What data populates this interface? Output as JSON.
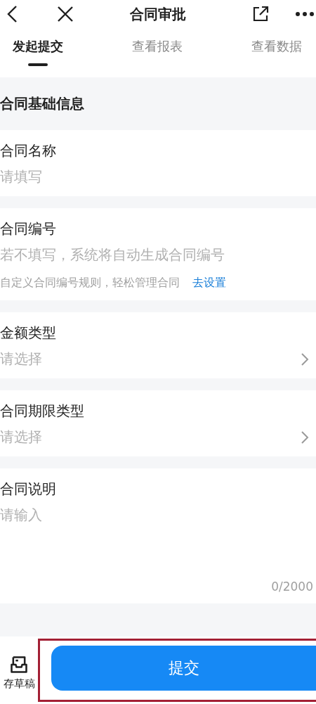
{
  "header": {
    "title": "合同审批"
  },
  "tabs": [
    {
      "label": "发起提交",
      "selected": true
    },
    {
      "label": "查看报表",
      "selected": false
    },
    {
      "label": "查看数据",
      "selected": false
    }
  ],
  "section": {
    "title": "合同基础信息"
  },
  "fields": [
    {
      "kind": "text",
      "label": "合同名称",
      "placeholder": "请填写"
    },
    {
      "kind": "text",
      "label": "合同编号",
      "placeholder": "若不填写，系统将自动生成合同编号",
      "hint": "自定义合同编号规则，轻松管理合同",
      "link": "去设置"
    },
    {
      "kind": "select",
      "label": "金额类型",
      "placeholder": "请选择"
    },
    {
      "kind": "select",
      "label": "合同期限类型",
      "placeholder": "请选择"
    },
    {
      "kind": "textarea",
      "label": "合同说明",
      "placeholder": "请输入",
      "counter": "0/2000"
    }
  ],
  "bottom_bar": {
    "draft_label": "存草稿",
    "submit_label": "提交"
  }
}
